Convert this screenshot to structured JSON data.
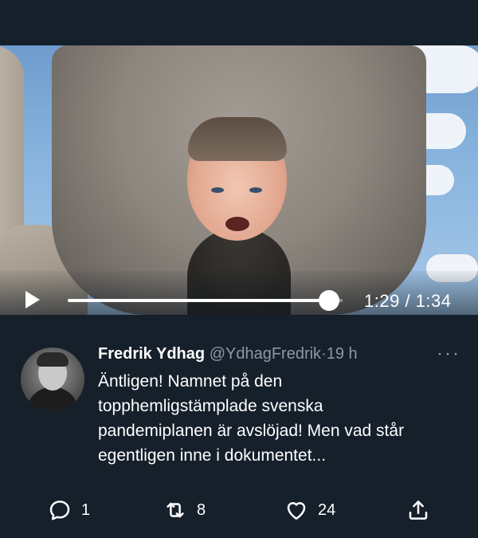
{
  "video": {
    "current_time": "1:29",
    "duration": "1:34",
    "progress": 0.95
  },
  "tweet": {
    "display_name": "Fredrik Ydhag",
    "handle": "@YdhagFredrik",
    "separator": "·",
    "age": "19 h",
    "more_label": "···",
    "text_lines": [
      "Äntligen! Namnet på den",
      "topphemligstämplade svenska",
      "pandemiplanen är avslöjad! Men vad står",
      "egentligen inne i dokumentet..."
    ]
  },
  "actions": {
    "reply_count": "1",
    "retweet_count": "8",
    "like_count": "24"
  },
  "colors": {
    "background": "#15202b",
    "secondary_text": "#8b98a5"
  },
  "icons": {
    "play": "play-icon",
    "reply": "reply-icon",
    "retweet": "retweet-icon",
    "like": "heart-icon",
    "share": "share-icon",
    "more": "more-icon"
  }
}
